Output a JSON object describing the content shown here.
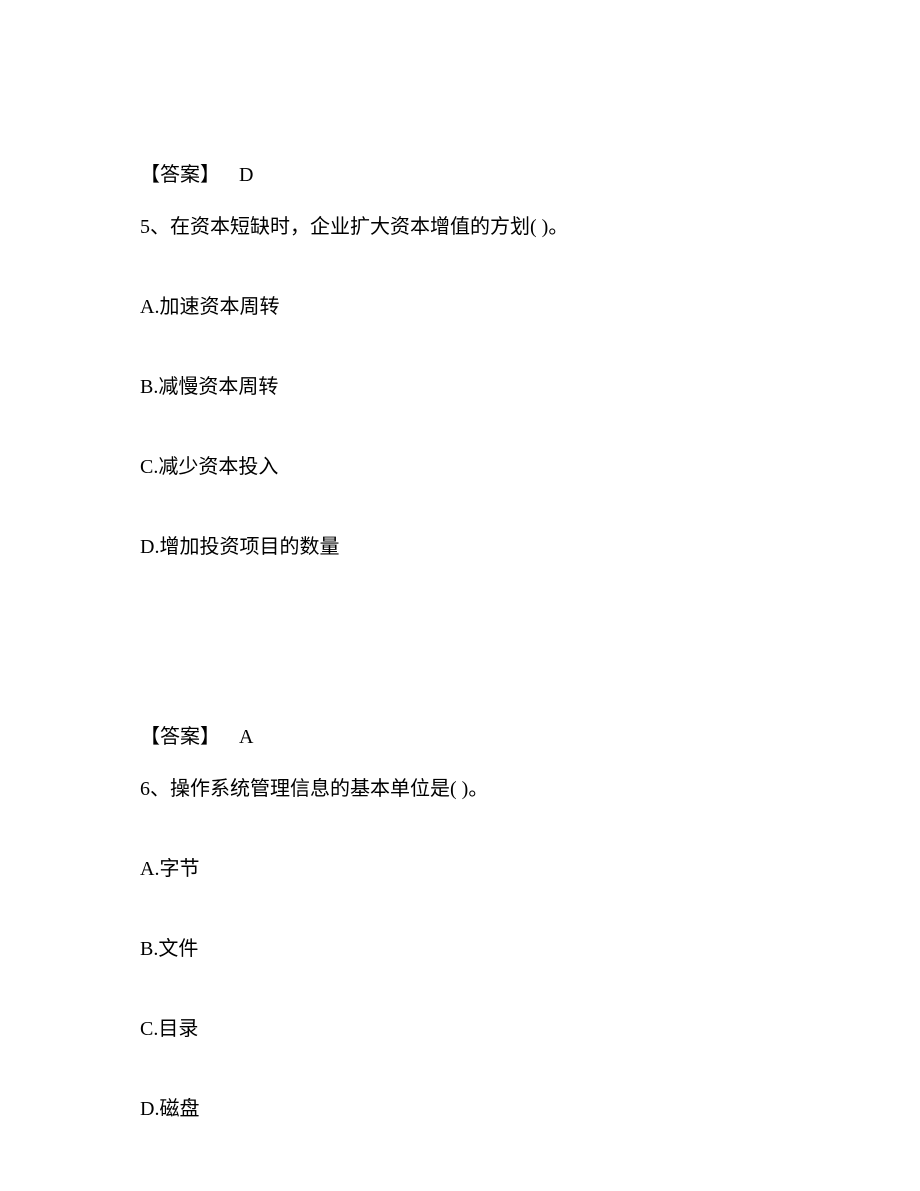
{
  "items": [
    {
      "type": "answer",
      "label": "【答案】",
      "value": "D"
    },
    {
      "type": "question",
      "text": "5、在资本短缺时，企业扩大资本增值的方划(  )。"
    },
    {
      "type": "option",
      "text": "A.加速资本周转"
    },
    {
      "type": "option",
      "text": "B.减慢资本周转"
    },
    {
      "type": "option",
      "text": "C.减少资本投入"
    },
    {
      "type": "option",
      "text": "D.增加投资项目的数量"
    },
    {
      "type": "gap"
    },
    {
      "type": "answer",
      "label": "【答案】",
      "value": "A"
    },
    {
      "type": "question",
      "text": "6、操作系统管理信息的基本单位是(  )。"
    },
    {
      "type": "option",
      "text": "A.字节"
    },
    {
      "type": "option",
      "text": "B.文件"
    },
    {
      "type": "option",
      "text": "C.目录"
    },
    {
      "type": "option",
      "text": "D.磁盘"
    }
  ]
}
